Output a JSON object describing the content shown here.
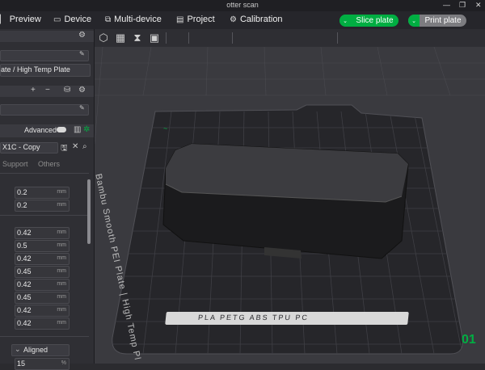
{
  "window": {
    "title": "otter scan"
  },
  "menu": {
    "preview": "Preview",
    "device": "Device",
    "multi_device": "Multi-device",
    "project": "Project",
    "calibration": "Calibration",
    "slice": "Slice plate",
    "print": "Print plate"
  },
  "sidebar": {
    "plate_type": "ate / High Temp Plate",
    "advanced_label": "Advanced",
    "preset_name": "X1C - Copy",
    "tabs": [
      "Support",
      "Others"
    ],
    "layer_values": [
      {
        "value": "0.2",
        "unit": "mm"
      },
      {
        "value": "0.2",
        "unit": "mm"
      }
    ],
    "width_values": [
      {
        "value": "0.42",
        "unit": "mm"
      },
      {
        "value": "0.5",
        "unit": "mm"
      },
      {
        "value": "0.42",
        "unit": "mm"
      },
      {
        "value": "0.45",
        "unit": "mm"
      },
      {
        "value": "0.42",
        "unit": "mm"
      },
      {
        "value": "0.45",
        "unit": "mm"
      },
      {
        "value": "0.42",
        "unit": "mm"
      },
      {
        "value": "0.42",
        "unit": "mm"
      }
    ],
    "seam_label": "Aligned",
    "bottom_value": "15",
    "bottom_unit": "%"
  },
  "plate": {
    "side_text": "Bambu Smooth PEI Plate | High Temp Pl",
    "bottom_text": "PLA PETG ABS TPU PC",
    "plate_number": "01"
  },
  "colors": {
    "accent": "#00ae42"
  }
}
